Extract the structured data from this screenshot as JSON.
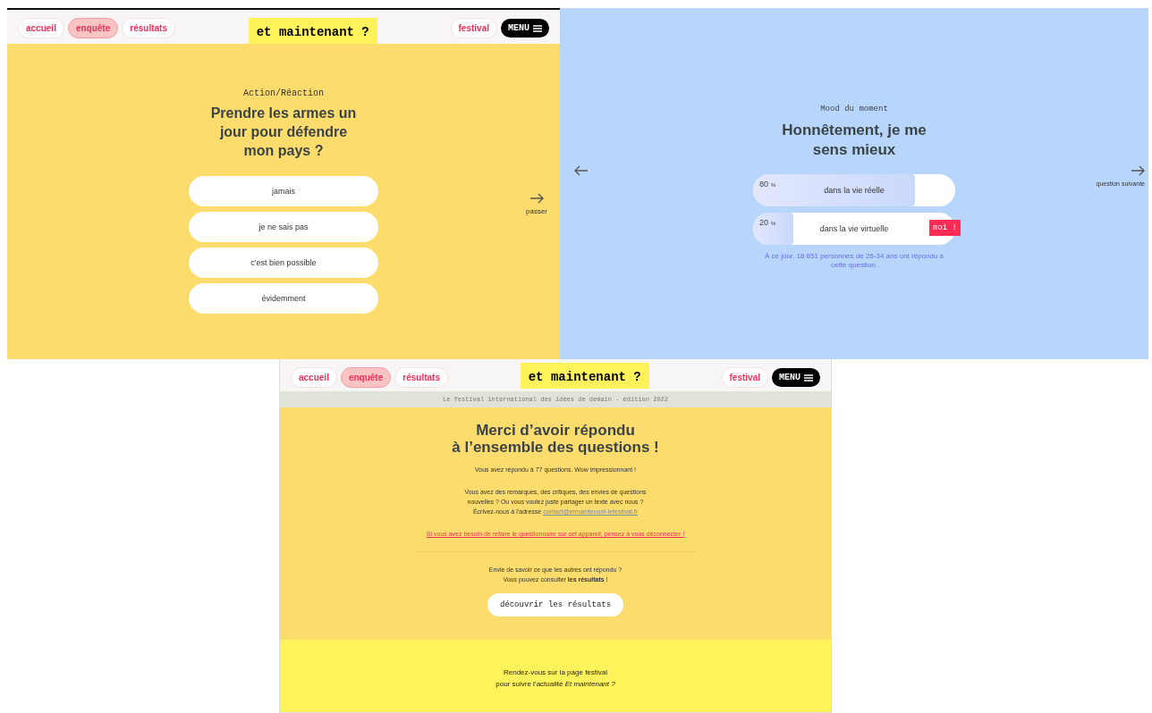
{
  "screen_1": {
    "header": {
      "nav": [
        {
          "label": "accueil",
          "selected": false
        },
        {
          "label": "enquête",
          "selected": true
        },
        {
          "label": "résultats",
          "selected": false
        }
      ],
      "logo": "et maintenant ?",
      "festival_link": "festival",
      "menu_button": "MENU"
    },
    "category": "Action/Réaction",
    "question": "Prendre les armes un\njour pour défendre\nmon pays ?",
    "answers": [
      "jamais",
      "je ne sais pas",
      "c'est bien possible",
      "évidemment"
    ],
    "skip": "passer"
  },
  "screen_2": {
    "category": "Mood du moment",
    "question": "Honnêtement, je me\nsens mieux",
    "results": [
      {
        "percent": "80",
        "unit": "%",
        "label": "dans la vie réelle",
        "level": 0.8,
        "mine": false
      },
      {
        "percent": "20",
        "unit": "%",
        "label": "dans la vie virtuelle",
        "level": 0.2,
        "mine": true
      }
    ],
    "mine_label": "moi !",
    "note": "À ce jour, 18 851 personnes de 26-34 ans ont répondu à\ncette question.",
    "next": "question suivante"
  },
  "screen_3": {
    "header": {
      "nav": [
        {
          "label": "accueil",
          "selected": false
        },
        {
          "label": "enquête",
          "selected": true
        },
        {
          "label": "résultats",
          "selected": false
        }
      ],
      "logo": "et maintenant ?",
      "festival_link": "festival",
      "menu_button": "MENU"
    },
    "banner": "Le festival international des idées de demain - édition 2022",
    "title": "Merci d’avoir répondu\nà l’ensemble des questions !",
    "count_text": "Vous avez répondu à 77 questions. Wow impressionnant !",
    "contact_text": "Vous avez des remarques, des critiques, des envies de questions\nnouvelles ? Ou vous voulez juste partager un texte avec nous ?\nÉcrivez-nous à l’adresse ",
    "contact_link": "contact@etmaintenant-lefestival.fr",
    "logout_warning": "Si vous avez besoin de refaire le questionnaire sur cet appareil, pensez à vous déconnecter !",
    "results_text": "Envie de savoir ce que les autres ont répondu ?\nVous pouvez consulter **les résultats** !",
    "results_button": "découvrir les résultats",
    "footer_text": "Rendez-vous sur la page festival\npour suivre l’actualité *Et maintenant ?*"
  }
}
